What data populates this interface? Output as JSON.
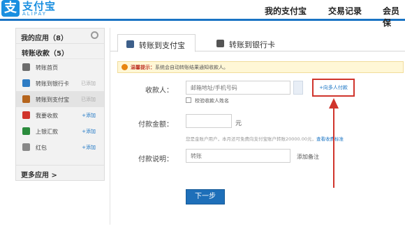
{
  "header": {
    "logo_glyph": "支",
    "logo_cn": "支付宝",
    "logo_en": "ALIPAY",
    "nav": [
      "我的支付宝",
      "交易记录",
      "会员保"
    ]
  },
  "sidebar": {
    "my_apps": "我的应用（8）",
    "section": "转账收款（5）",
    "items": [
      {
        "label": "转账首页",
        "tag": "",
        "icon": "home-icon",
        "color": "#6c6c6c"
      },
      {
        "label": "转账到银行卡",
        "tag": "已添加",
        "icon": "bank-card-icon",
        "color": "#2e7cc4"
      },
      {
        "label": "转账到支付宝",
        "tag": "已添加",
        "icon": "alipay-transfer-icon",
        "color": "#b5651d"
      },
      {
        "label": "我要收款",
        "tag": "+添加",
        "icon": "collect-money-icon",
        "color": "#d0342c"
      },
      {
        "label": "上银汇款",
        "tag": "+添加",
        "icon": "remittance-icon",
        "color": "#2a8b3c"
      },
      {
        "label": "红包",
        "tag": "+添加",
        "icon": "red-packet-icon",
        "color": "#888888"
      }
    ],
    "more": "更多应用 >"
  },
  "tabs": [
    {
      "label": "转账到支付宝",
      "icon": "shield-icon"
    },
    {
      "label": "转账到银行卡",
      "icon": "card-icon"
    }
  ],
  "notice": {
    "strong": "温馨提示：",
    "text": "系统会自动转账结果通知收款人。"
  },
  "form": {
    "payee_label": "收款人：",
    "payee_placeholder": "邮箱地址/手机号码",
    "multi_pay": "+向多人付款",
    "verify_name": "校验收款人姓名",
    "amount_label": "付款金额：",
    "amount_unit": "元",
    "hint": "您是金账户用户，本月还可免费向支付宝账户转账20000.00元，",
    "hint_link": "查看收费标准",
    "memo_label": "付款说明：",
    "memo_placeholder": "转账",
    "memo_add": "添加备注",
    "submit": "下一步"
  },
  "colors": {
    "brand": "#1a74c4",
    "highlight": "#d0342c"
  }
}
